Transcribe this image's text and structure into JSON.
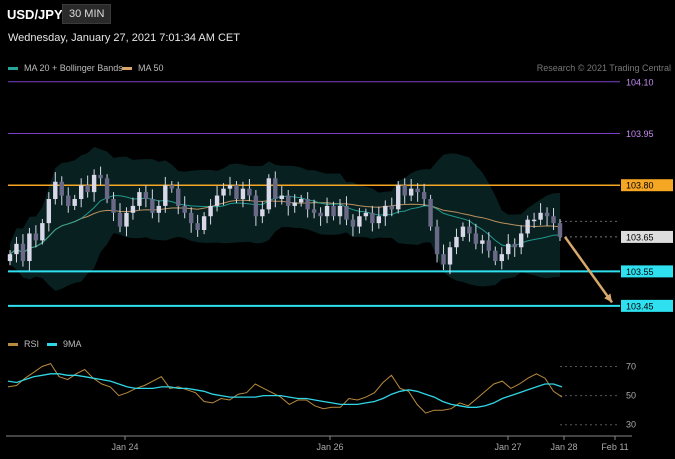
{
  "header": {
    "symbol": "USD/JPY",
    "timeframe": "30 MIN"
  },
  "timestamp": "Wednesday, January 27, 2021 7:01:34 AM CET",
  "legend_main": [
    {
      "label": "MA 20 + Bollinger Bands",
      "color": "#26a69a"
    },
    {
      "label": "MA 50",
      "color": "#d9a56a"
    }
  ],
  "credit": "Research © 2021 Trading Central",
  "legend_rsi": [
    {
      "label": "RSI",
      "color": "#b98a3d"
    },
    {
      "label": "9MA",
      "color": "#2fd6e6"
    }
  ],
  "colors": {
    "resistance": "#f5a623",
    "support": "#2fe0f0",
    "target_line": "#7b3fc4",
    "arrow": "#d8a86c",
    "candle": "#d8d8e8"
  },
  "chart_data": [
    {
      "type": "candlestick",
      "title": "USD/JPY 30 MIN",
      "x_tick_labels": [
        "Jan 24",
        "Jan 26",
        "Jan 27",
        "Jan 28",
        "Feb 11"
      ],
      "ylim": [
        103.38,
        104.14
      ],
      "levels": [
        {
          "label": "104.10",
          "value": 104.1,
          "role": "target"
        },
        {
          "label": "103.95",
          "value": 103.95,
          "role": "target"
        },
        {
          "label": "103.80",
          "value": 103.8,
          "role": "resistance"
        },
        {
          "label": "103.65",
          "value": 103.65,
          "role": "last price"
        },
        {
          "label": "103.55",
          "value": 103.55,
          "role": "support"
        },
        {
          "label": "103.45",
          "value": 103.45,
          "role": "support"
        }
      ],
      "close": [
        103.6,
        103.63,
        103.58,
        103.66,
        103.64,
        103.69,
        103.76,
        103.81,
        103.77,
        103.74,
        103.76,
        103.8,
        103.78,
        103.83,
        103.82,
        103.76,
        103.72,
        103.68,
        103.72,
        103.74,
        103.78,
        103.76,
        103.72,
        103.74,
        103.8,
        103.79,
        103.74,
        103.72,
        103.69,
        103.67,
        103.71,
        103.74,
        103.77,
        103.79,
        103.8,
        103.76,
        103.79,
        103.77,
        103.71,
        103.73,
        103.82,
        103.76,
        103.77,
        103.74,
        103.75,
        103.76,
        103.73,
        103.72,
        103.71,
        103.74,
        103.71,
        103.74,
        103.7,
        103.68,
        103.71,
        103.72,
        103.69,
        103.71,
        103.74,
        103.73,
        103.8,
        103.77,
        103.79,
        103.78,
        103.76,
        103.68,
        103.6,
        103.57,
        103.62,
        103.65,
        103.68,
        103.66,
        103.63,
        103.64,
        103.61,
        103.58,
        103.6,
        103.63,
        103.62,
        103.66,
        103.7,
        103.7,
        103.72,
        103.71,
        103.69,
        103.65
      ]
    },
    {
      "type": "line",
      "title": "RSI",
      "series": [
        {
          "name": "RSI",
          "values": [
            56,
            57,
            62,
            66,
            70,
            72,
            63,
            61,
            65,
            68,
            62,
            58,
            56,
            50,
            52,
            55,
            57,
            60,
            63,
            55,
            56,
            54,
            52,
            46,
            45,
            48,
            47,
            51,
            52,
            58,
            55,
            52,
            49,
            44,
            47,
            47,
            43,
            41,
            42,
            42,
            48,
            47,
            49,
            52,
            59,
            64,
            55,
            53,
            44,
            38,
            40,
            40,
            41,
            45,
            43,
            48,
            53,
            58,
            60,
            55,
            58,
            62,
            65,
            62,
            53,
            49
          ]
        },
        {
          "name": "9MA",
          "values": [
            60,
            59,
            61,
            63,
            64,
            65,
            65,
            64,
            64,
            63,
            62,
            61,
            60,
            58,
            56,
            55,
            55,
            55,
            56,
            56,
            55,
            55,
            54,
            53,
            51,
            50,
            49,
            49,
            49,
            49,
            50,
            50,
            50,
            49,
            48,
            48,
            47,
            46,
            45,
            44,
            44,
            44,
            45,
            46,
            48,
            51,
            53,
            54,
            53,
            51,
            49,
            46,
            44,
            43,
            42,
            42,
            43,
            45,
            48,
            50,
            52,
            54,
            56,
            58,
            58,
            56
          ]
        }
      ],
      "ylim": [
        25,
        80
      ],
      "y_ticks": [
        70,
        50,
        30
      ],
      "y_tick_labels": [
        "70",
        "50",
        "30"
      ]
    }
  ]
}
